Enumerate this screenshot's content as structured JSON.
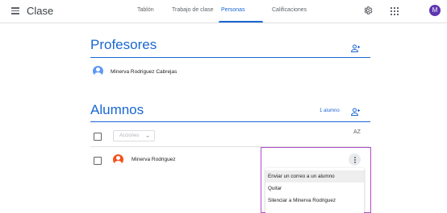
{
  "app": {
    "title": "Clase",
    "avatar_letter": "M"
  },
  "tabs": [
    {
      "label": "Tablón",
      "active": false
    },
    {
      "label": "Trabajo de clase",
      "active": false
    },
    {
      "label": "Personas",
      "active": true
    },
    {
      "label": "Calificaciones",
      "active": false
    }
  ],
  "colors": {
    "accent": "#1967d2",
    "avatar_top": "#5e35b1",
    "highlight": "#b04dc9"
  },
  "teachers": {
    "title": "Profesores",
    "items": [
      {
        "name": "Minerva Rodriguez Cabrejas",
        "avatar_color": "#5e97f6"
      }
    ]
  },
  "students": {
    "title": "Alumnos",
    "count_label": "1 alumno",
    "actions_label": "Acciones",
    "sort_label": "AZ",
    "items": [
      {
        "name": "Minerva Rodriguez",
        "avatar_color": "#f4511e"
      }
    ]
  },
  "context_menu": {
    "items": [
      {
        "label": "Enviar un correo a un alumno",
        "hovered": true
      },
      {
        "label": "Quitar",
        "hovered": false
      },
      {
        "label": "Silenciar a Minerva Rodriguez",
        "hovered": false
      }
    ]
  }
}
